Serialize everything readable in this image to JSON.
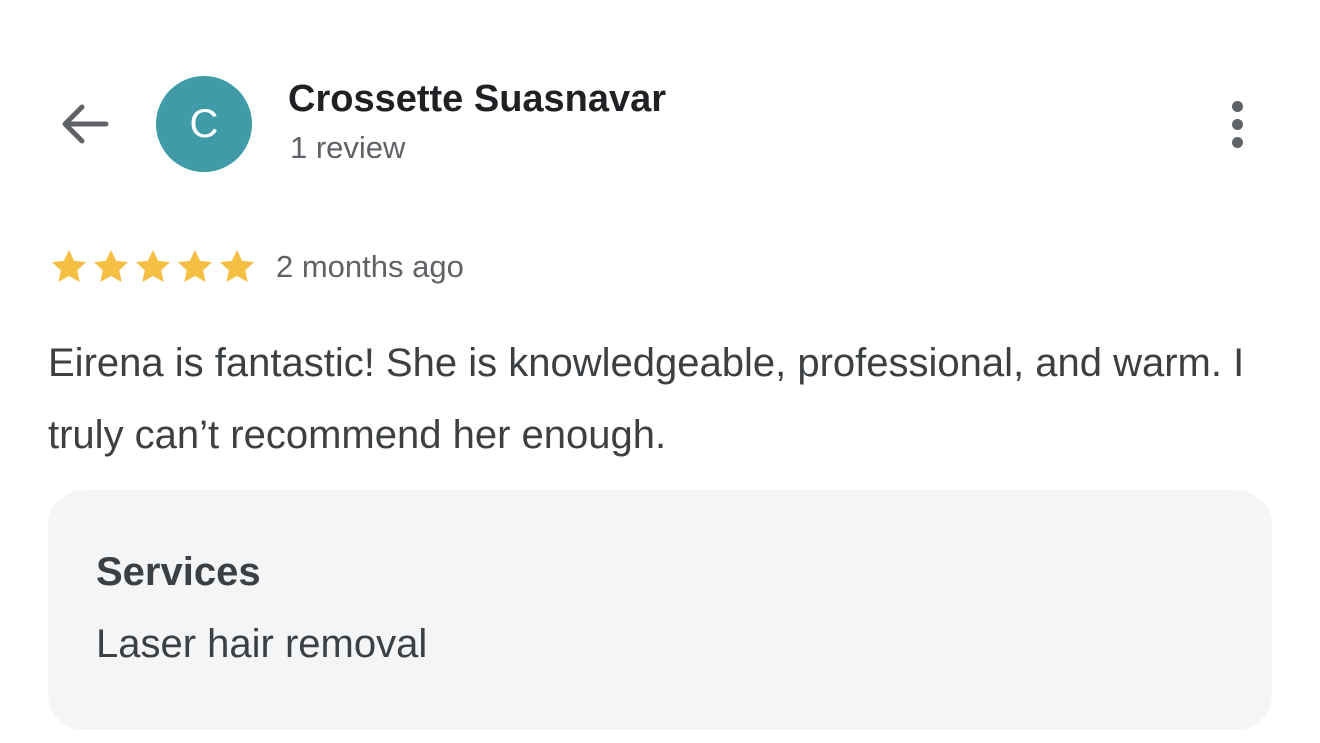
{
  "colors": {
    "avatar_bg": "#3f9ba8",
    "star": "#f4bf42",
    "icon": "#5f6368",
    "card_bg": "#f4f5f7"
  },
  "header": {
    "back_icon": "arrow-left-icon",
    "avatar_letter": "C",
    "reviewer_name": "Crossette Suasnavar",
    "review_count": "1 review",
    "more_icon": "more-vert-icon"
  },
  "review": {
    "rating": 5,
    "rating_max": 5,
    "date": "2 months ago",
    "text": "Eirena is fantastic! She is knowledgeable, professional, and warm. I truly can’t recommend her enough."
  },
  "services": {
    "title": "Services",
    "value": "Laser hair removal"
  }
}
